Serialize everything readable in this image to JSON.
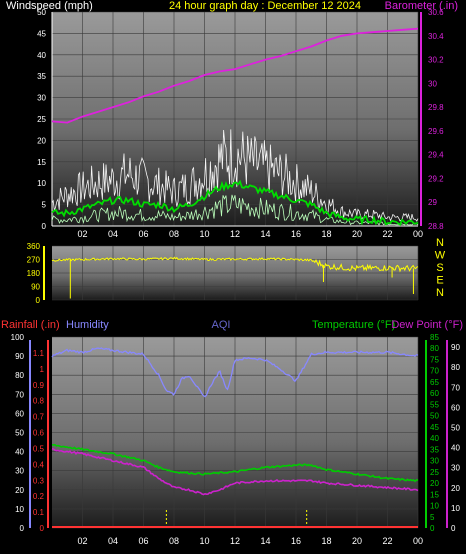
{
  "colors": {
    "wind": "#ffffff",
    "gust": "#d9d9d9",
    "wind_avg": "#00dd00",
    "barometer": "#dd22dd",
    "direction": "#ffff00",
    "humidity": "#8888ff",
    "rain": "#ff3333",
    "temperature": "#00cc00",
    "dewpoint": "#cc22cc",
    "header_yellow": "#ffff00",
    "aqi": "#6666cc"
  },
  "chart_data": [
    {
      "type": "line",
      "title": "24 hour graph day : December 12 2024",
      "left_label": "Windspeed (mph)",
      "right_label": "Barometer (.in)",
      "x_ticks": [
        "02",
        "04",
        "06",
        "08",
        "10",
        "12",
        "14",
        "16",
        "18",
        "20",
        "22",
        "00"
      ],
      "y_left_ticks": [
        "0",
        "5",
        "10",
        "15",
        "20",
        "25",
        "30",
        "35",
        "40",
        "45",
        "50"
      ],
      "y_right_ticks": [
        "28.8",
        "29",
        "29.2",
        "29.4",
        "29.6",
        "29.8",
        "30",
        "30.2",
        "30.4",
        "30.6"
      ],
      "ylim_left": [
        0,
        50
      ],
      "ylim_right": [
        28.8,
        30.6
      ],
      "xlim": [
        0,
        24
      ],
      "series": [
        {
          "key": "barometer",
          "axis": "right",
          "x": [
            0,
            1,
            2,
            3,
            4,
            5,
            6,
            7,
            8,
            9,
            10,
            11,
            12,
            13,
            14,
            15,
            16,
            17,
            18,
            19,
            20,
            21,
            22,
            23,
            24
          ],
          "values": [
            29.68,
            29.67,
            29.72,
            29.76,
            29.8,
            29.84,
            29.89,
            29.93,
            29.98,
            30.02,
            30.07,
            30.1,
            30.12,
            30.16,
            30.2,
            30.23,
            30.27,
            30.31,
            30.36,
            30.4,
            30.42,
            30.43,
            30.44,
            30.45,
            30.46
          ]
        },
        {
          "key": "gust",
          "axis": "left",
          "x": [
            0,
            1,
            2,
            3,
            4,
            5,
            6,
            7,
            8,
            9,
            10,
            11,
            12,
            13,
            14,
            15,
            16,
            17,
            18,
            19,
            20,
            21,
            22,
            23,
            24
          ],
          "values": [
            8,
            11,
            13,
            15,
            16,
            18,
            16,
            14,
            12,
            14,
            18,
            23,
            25,
            22,
            20,
            18,
            15,
            12,
            8,
            5,
            4,
            4,
            3,
            3,
            3
          ]
        },
        {
          "key": "wind_avg",
          "axis": "left",
          "x": [
            0,
            1,
            2,
            3,
            4,
            5,
            6,
            7,
            8,
            9,
            10,
            11,
            12,
            13,
            14,
            15,
            16,
            17,
            18,
            19,
            20,
            21,
            22,
            23,
            24
          ],
          "values": [
            3,
            3,
            4,
            5,
            6,
            6,
            5,
            5,
            4,
            5,
            7,
            9,
            10,
            9,
            8,
            7,
            6,
            5,
            3,
            2,
            1.5,
            1.5,
            1,
            1,
            1
          ]
        }
      ]
    },
    {
      "type": "line",
      "left_ticks": [
        "0",
        "90",
        "180",
        "270",
        "360"
      ],
      "right_labels": [
        "N",
        "W",
        "S",
        "E",
        "N"
      ],
      "ylim": [
        0,
        360
      ],
      "xlim": [
        0,
        24
      ],
      "series": [
        {
          "key": "direction",
          "x": [
            0,
            2,
            4,
            6,
            8,
            10,
            12,
            14,
            16,
            17,
            18,
            20,
            22,
            24
          ],
          "values": [
            265,
            270,
            275,
            272,
            278,
            270,
            272,
            275,
            270,
            265,
            225,
            210,
            215,
            210
          ]
        }
      ]
    },
    {
      "type": "line",
      "labels": {
        "rain": "Rainfall (.in)",
        "humidity": "Humidity",
        "aqi": "AQI",
        "temperature": "Temperature (°F)",
        "dewpoint": "Dew Point (°F)"
      },
      "x_ticks": [
        "02",
        "04",
        "06",
        "08",
        "10",
        "12",
        "14",
        "16",
        "18",
        "20",
        "22",
        "00"
      ],
      "rain_ticks": [
        "0",
        "0.1",
        "0.2",
        "0.3",
        "0.4",
        "0.5",
        "0.6",
        "0.7",
        "0.8",
        "0.9",
        "1",
        "1.1"
      ],
      "hum_ticks": [
        "0",
        "10",
        "20",
        "30",
        "40",
        "50",
        "60",
        "70",
        "80",
        "90",
        "100"
      ],
      "temp_ticks": [
        "0",
        "5",
        "10",
        "15",
        "20",
        "25",
        "30",
        "35",
        "40",
        "45",
        "50",
        "55",
        "60",
        "65",
        "70",
        "75",
        "80",
        "85"
      ],
      "dew_ticks": [
        "0",
        "10",
        "20",
        "30",
        "40",
        "50",
        "60",
        "70",
        "80",
        "90"
      ],
      "ylim_rain": [
        0,
        1.2
      ],
      "ylim_humidity": [
        0,
        100
      ],
      "ylim_temp": [
        0,
        85
      ],
      "xlim": [
        0,
        24
      ],
      "series": [
        {
          "key": "humidity",
          "x": [
            0,
            1,
            2,
            3,
            4,
            5,
            6,
            7,
            7.5,
            8,
            8.5,
            9,
            9.5,
            10,
            10.5,
            11,
            11.5,
            12,
            13,
            14,
            15,
            16,
            17,
            18,
            20,
            22,
            24
          ],
          "values": [
            90,
            93,
            92,
            94,
            93,
            92,
            91,
            80,
            72,
            70,
            78,
            80,
            74,
            68,
            76,
            82,
            72,
            88,
            89,
            88,
            83,
            77,
            91,
            92,
            92,
            92,
            90
          ]
        },
        {
          "key": "temperature",
          "x": [
            0,
            2,
            4,
            6,
            7,
            8,
            10,
            12,
            14,
            16,
            17,
            18,
            20,
            22,
            24
          ],
          "values": [
            37,
            35,
            33,
            30,
            27,
            25,
            24,
            25,
            27,
            28,
            28,
            26,
            24,
            22,
            21
          ]
        },
        {
          "key": "dewpoint",
          "x": [
            0,
            2,
            4,
            6,
            7,
            8,
            9,
            10,
            11,
            12,
            14,
            16,
            17,
            18,
            20,
            22,
            24
          ],
          "values": [
            35,
            33,
            30,
            27,
            22,
            18,
            17,
            15,
            17,
            20,
            21,
            21,
            21,
            20,
            19,
            18,
            17
          ]
        },
        {
          "key": "rain",
          "x": [
            0,
            24
          ],
          "values": [
            0,
            0
          ]
        }
      ]
    }
  ]
}
